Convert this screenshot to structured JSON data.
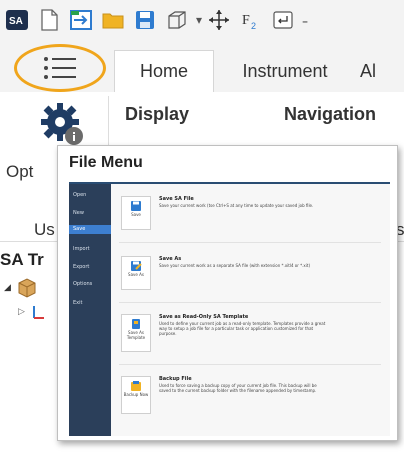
{
  "quick_access": {
    "items": [
      {
        "name": "sa-logo-icon"
      },
      {
        "name": "new-file-icon"
      },
      {
        "name": "open-icon"
      },
      {
        "name": "folder-icon"
      },
      {
        "name": "save-icon"
      },
      {
        "name": "cube-icon"
      },
      {
        "name": "dropdown-arrow-icon"
      },
      {
        "name": "move-icon"
      },
      {
        "name": "f2-icon"
      },
      {
        "name": "enter-icon"
      },
      {
        "name": "customize-arrow-icon"
      }
    ],
    "customize_glyph": "₌"
  },
  "tabs": {
    "home": "Home",
    "instrument": "Instrument",
    "partial": "Al"
  },
  "ribbon": {
    "display": "Display",
    "navigation": "Navigation",
    "options_partial": "Opt",
    "usage_partial": "Us",
    "right_partial": "s"
  },
  "tree": {
    "title": "SA Tr"
  },
  "file_menu": {
    "title": "File Menu",
    "sidebar": [
      "Open",
      "New",
      "Save",
      "Import",
      "Export",
      "Options",
      "Exit"
    ],
    "selected_index": 2,
    "entries": [
      {
        "heading": "Save SA File",
        "desc": "Save your current work (tse Ctrl+S at any time to update your saved job file.",
        "button": "Save"
      },
      {
        "heading": "Save As",
        "desc": "Save your current work as a separate SA file (with extension *.xitl4 or *.xit)",
        "button": "Save As"
      },
      {
        "heading": "Save as Read-Only SA Template",
        "desc": "Used to define your current job as a read-only template. Templates provide a great way to setup a job file for a particular task or application customized for that purpose.",
        "button": "Save As Template"
      },
      {
        "heading": "Backup File",
        "desc": "Used to force saving a backup copy of your current job file. This backup will be saved to the current backup folder with the filename appended by timestamp.",
        "button": "Backup Now"
      }
    ]
  },
  "colors": {
    "accent_ring": "#f0a51b",
    "preview_sidebar": "#2b3f5a",
    "preview_selected": "#3d7fd0",
    "preview_stripe": "#2a4d73"
  }
}
